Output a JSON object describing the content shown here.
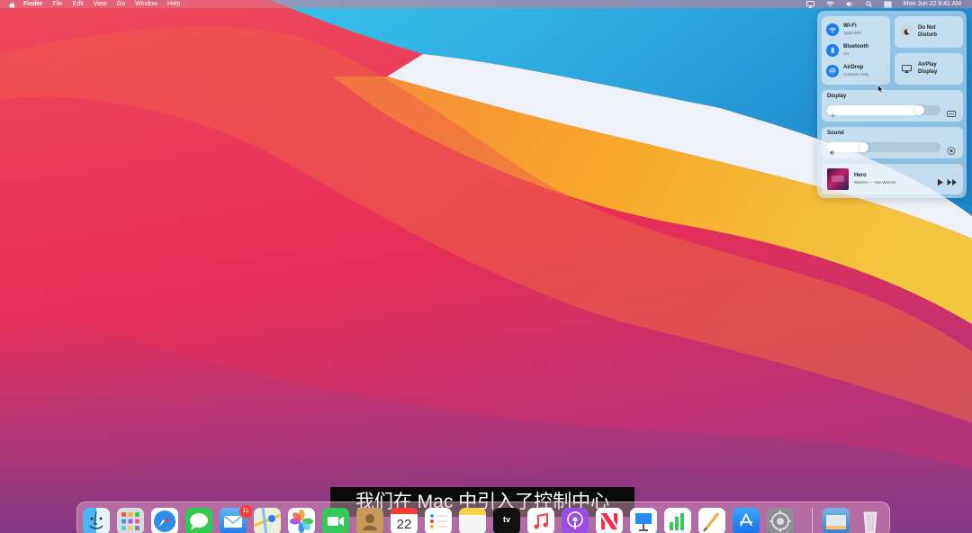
{
  "menubar": {
    "apple_icon": "apple-icon",
    "menus": [
      "Finder",
      "File",
      "Edit",
      "View",
      "Go",
      "Window",
      "Help"
    ],
    "status_icons": [
      "airplay-icon",
      "wifi-icon",
      "volume-icon",
      "search-icon",
      "control-center-icon"
    ],
    "clock": "Mon Jun 22  9:41 AM"
  },
  "control_center": {
    "wifi": {
      "title": "Wi-Fi",
      "subtitle": "AppleWiFi"
    },
    "bluetooth": {
      "title": "Bluetooth",
      "subtitle": "On"
    },
    "airdrop": {
      "title": "AirDrop",
      "subtitle": "Contacts Only"
    },
    "do_not_disturb": {
      "label": "Do Not Disturb"
    },
    "airplay_display": {
      "label": "AirPlay Display"
    },
    "display": {
      "label": "Display",
      "level": 0.84
    },
    "sound": {
      "label": "Sound",
      "level": 0.3
    },
    "now_playing": {
      "title": "Hero",
      "artist": "Weezer — Van Weezer"
    }
  },
  "subtitle": "我们在 Mac 中引入了控制中心",
  "dock": {
    "calendar_day": "22",
    "tv_label": "tv",
    "mail_badge": "11",
    "apps": [
      "finder",
      "launchpad",
      "safari",
      "messages",
      "mail",
      "maps",
      "photos",
      "facetime",
      "contacts",
      "calendar",
      "reminders",
      "notes",
      "tv",
      "music",
      "podcasts",
      "news",
      "keynote",
      "numbers",
      "pages",
      "app-store",
      "system-preferences",
      "downloads-stack",
      "trash"
    ]
  },
  "colors": {
    "accent_blue": "#1e7cf0",
    "wallpaper_red": "#e83a5a",
    "wallpaper_blue": "#2fb4e6",
    "wallpaper_orange": "#f6a628"
  }
}
